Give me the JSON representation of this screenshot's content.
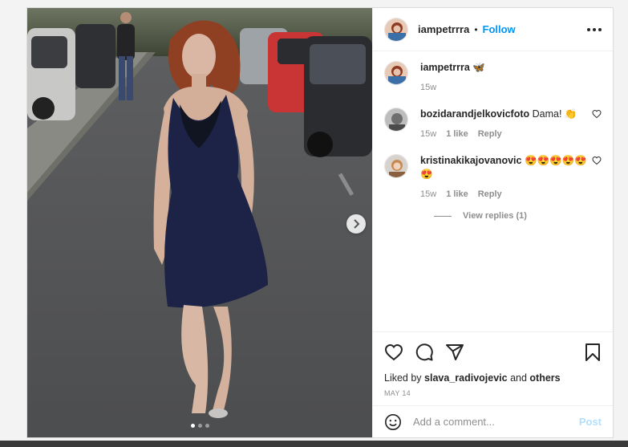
{
  "post": {
    "author": {
      "username": "iampetrrra",
      "separator": "•",
      "follow_label": "Follow"
    },
    "caption": {
      "username": "iampetrrra",
      "text": "🦋",
      "age": "15w"
    },
    "comments": [
      {
        "username": "bozidarandjelkovicfoto",
        "text": "Dama! 👏",
        "age": "15w",
        "likes": "1 like",
        "reply_label": "Reply"
      },
      {
        "username": "kristinakikajovanovic",
        "text": "😍😍😍😍😍😍",
        "age": "15w",
        "likes": "1 like",
        "reply_label": "Reply",
        "view_replies": "View replies (1)"
      }
    ],
    "likes": {
      "prefix": "Liked by",
      "user": "slava_radivojevic",
      "joiner": "and",
      "others": "others"
    },
    "date": "MAY 14",
    "add_comment": {
      "placeholder": "Add a comment...",
      "post_label": "Post"
    },
    "carousel": {
      "count": 3,
      "active_index": 0
    }
  },
  "icons": {
    "more": "more-options-icon",
    "like": "heart-icon",
    "comment": "comment-icon",
    "share": "share-icon",
    "save": "bookmark-icon",
    "emoji": "emoji-icon",
    "next": "chevron-right-icon"
  },
  "colors": {
    "follow": "#0095f6",
    "post_disabled": "#b2dffc",
    "muted": "#8e8e8e"
  }
}
